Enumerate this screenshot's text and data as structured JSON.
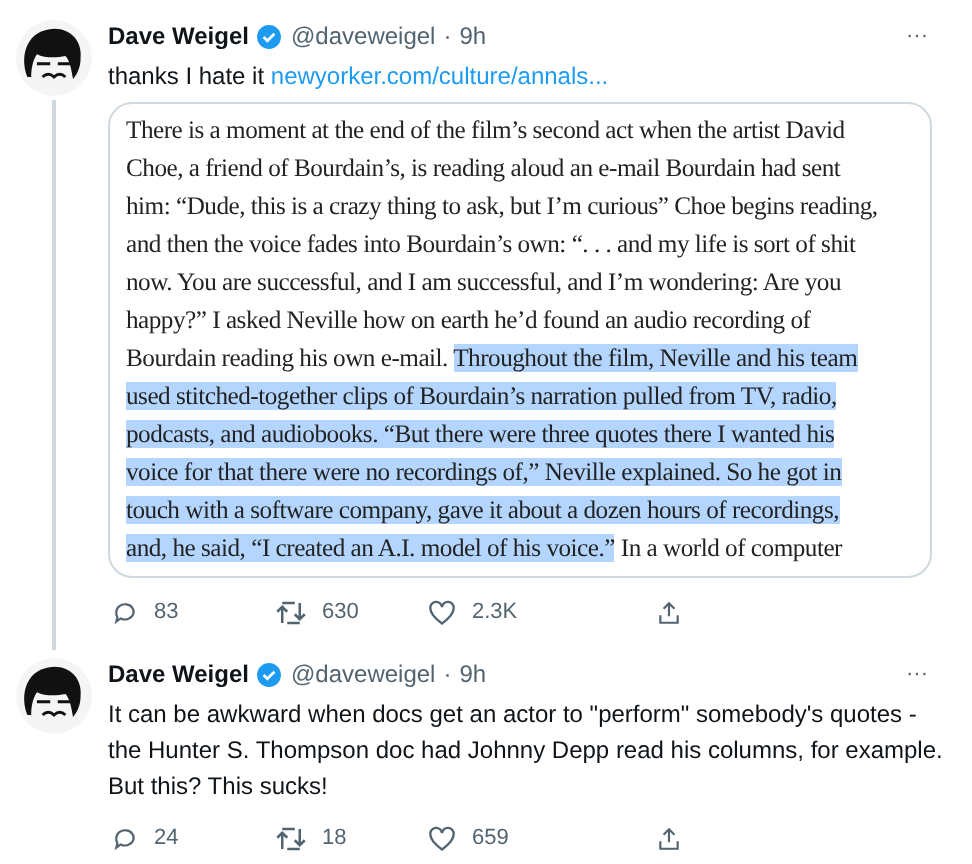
{
  "tweets": [
    {
      "name": "Dave Weigel",
      "verified": true,
      "handle": "@daveweigel",
      "separator": "·",
      "time": "9h",
      "more": "···",
      "thread_line": true,
      "text": [
        {
          "kind": "plain",
          "text": "thanks I hate it "
        },
        {
          "kind": "link",
          "text": "newyorker.com/culture/annals..."
        }
      ],
      "quote_image": {
        "lines": [
          [
            {
              "text": "There is a moment at the end of the film’s second act when the artist David",
              "highlighted": false
            }
          ],
          [
            {
              "text": "Choe, a friend of Bourdain’s, is reading aloud an e-mail Bourdain had sent",
              "highlighted": false
            }
          ],
          [
            {
              "text": "him: “Dude, this is a crazy thing to ask, but I’m curious” Choe begins reading,",
              "highlighted": false
            }
          ],
          [
            {
              "text": "and then the voice fades into Bourdain’s own: “. . . and my life is sort of shit",
              "highlighted": false
            }
          ],
          [
            {
              "text": "now. You are successful, and I am successful, and I’m wondering: Are you",
              "highlighted": false
            }
          ],
          [
            {
              "text": "happy?” I asked Neville how on earth he’d found an audio recording of",
              "highlighted": false
            }
          ],
          [
            {
              "text": "Bourdain reading his own e-mail. ",
              "highlighted": false
            },
            {
              "text": "Throughout the film, Neville and his team",
              "highlighted": true
            }
          ],
          [
            {
              "text": "used stitched-together clips of Bourdain’s narration pulled from TV, radio,",
              "highlighted": true
            }
          ],
          [
            {
              "text": "podcasts, and audiobooks. “But there were three quotes there I wanted his",
              "highlighted": true
            }
          ],
          [
            {
              "text": "voice for that there were no recordings of,” Neville explained. So he got in",
              "highlighted": true
            }
          ],
          [
            {
              "text": "touch with a software company, gave it about a dozen hours of recordings,",
              "highlighted": true
            }
          ],
          [
            {
              "text": "and, he said, “I created an A.I. model of his voice.”",
              "highlighted": true
            },
            {
              "text": " In a world of computer",
              "highlighted": false
            }
          ]
        ]
      },
      "actions": [
        {
          "kind": "reply",
          "count": "83"
        },
        {
          "kind": "retweet",
          "count": "630"
        },
        {
          "kind": "like",
          "count": "2.3K"
        },
        {
          "kind": "share"
        }
      ]
    },
    {
      "name": "Dave Weigel",
      "verified": true,
      "handle": "@daveweigel",
      "separator": "·",
      "time": "9h",
      "more": "···",
      "thread_line": false,
      "text": [
        {
          "kind": "plain",
          "text": "It can be awkward when docs get an actor to \"perform\" somebody's quotes - the Hunter S. Thompson doc had Johnny Depp read his columns, for example. But this? This sucks!"
        }
      ],
      "actions": [
        {
          "kind": "reply",
          "count": "24"
        },
        {
          "kind": "retweet",
          "count": "18"
        },
        {
          "kind": "like",
          "count": "659"
        },
        {
          "kind": "share"
        }
      ]
    }
  ]
}
